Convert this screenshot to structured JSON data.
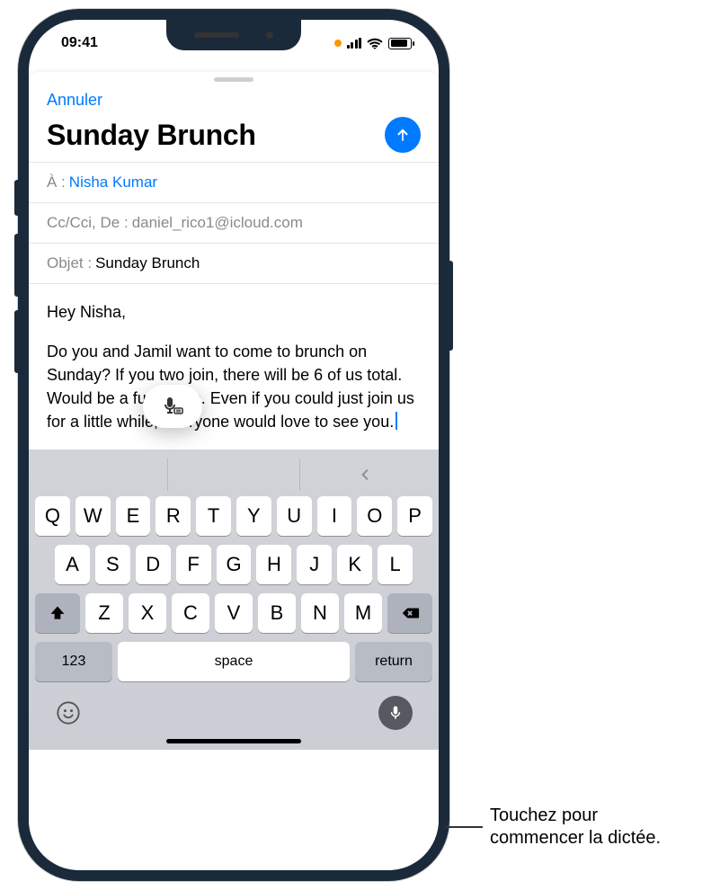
{
  "status": {
    "time": "09:41"
  },
  "sheet": {
    "cancel": "Annuler",
    "title": "Sunday Brunch",
    "to_label": "À :",
    "to_recipient": "Nisha Kumar",
    "cc_label": "Cc/Cci, De :",
    "cc_from": "daniel_rico1@icloud.com",
    "subject_label": "Objet :",
    "subject": "Sunday Brunch",
    "body_greeting": "Hey Nisha,",
    "body_main": "Do you and Jamil want to come to brunch on Sunday? If you two join, there will be 6 of us total. Would be a fun group. Even if you could just join us for a little while, everyone would love to see you."
  },
  "keyboard": {
    "row1": [
      "Q",
      "W",
      "E",
      "R",
      "T",
      "Y",
      "U",
      "I",
      "O",
      "P"
    ],
    "row2": [
      "A",
      "S",
      "D",
      "F",
      "G",
      "H",
      "J",
      "K",
      "L"
    ],
    "row3": [
      "Z",
      "X",
      "C",
      "V",
      "B",
      "N",
      "M"
    ],
    "num": "123",
    "space": "space",
    "ret": "return"
  },
  "callout": {
    "line1": "Touchez pour",
    "line2": "commencer la dictée."
  }
}
